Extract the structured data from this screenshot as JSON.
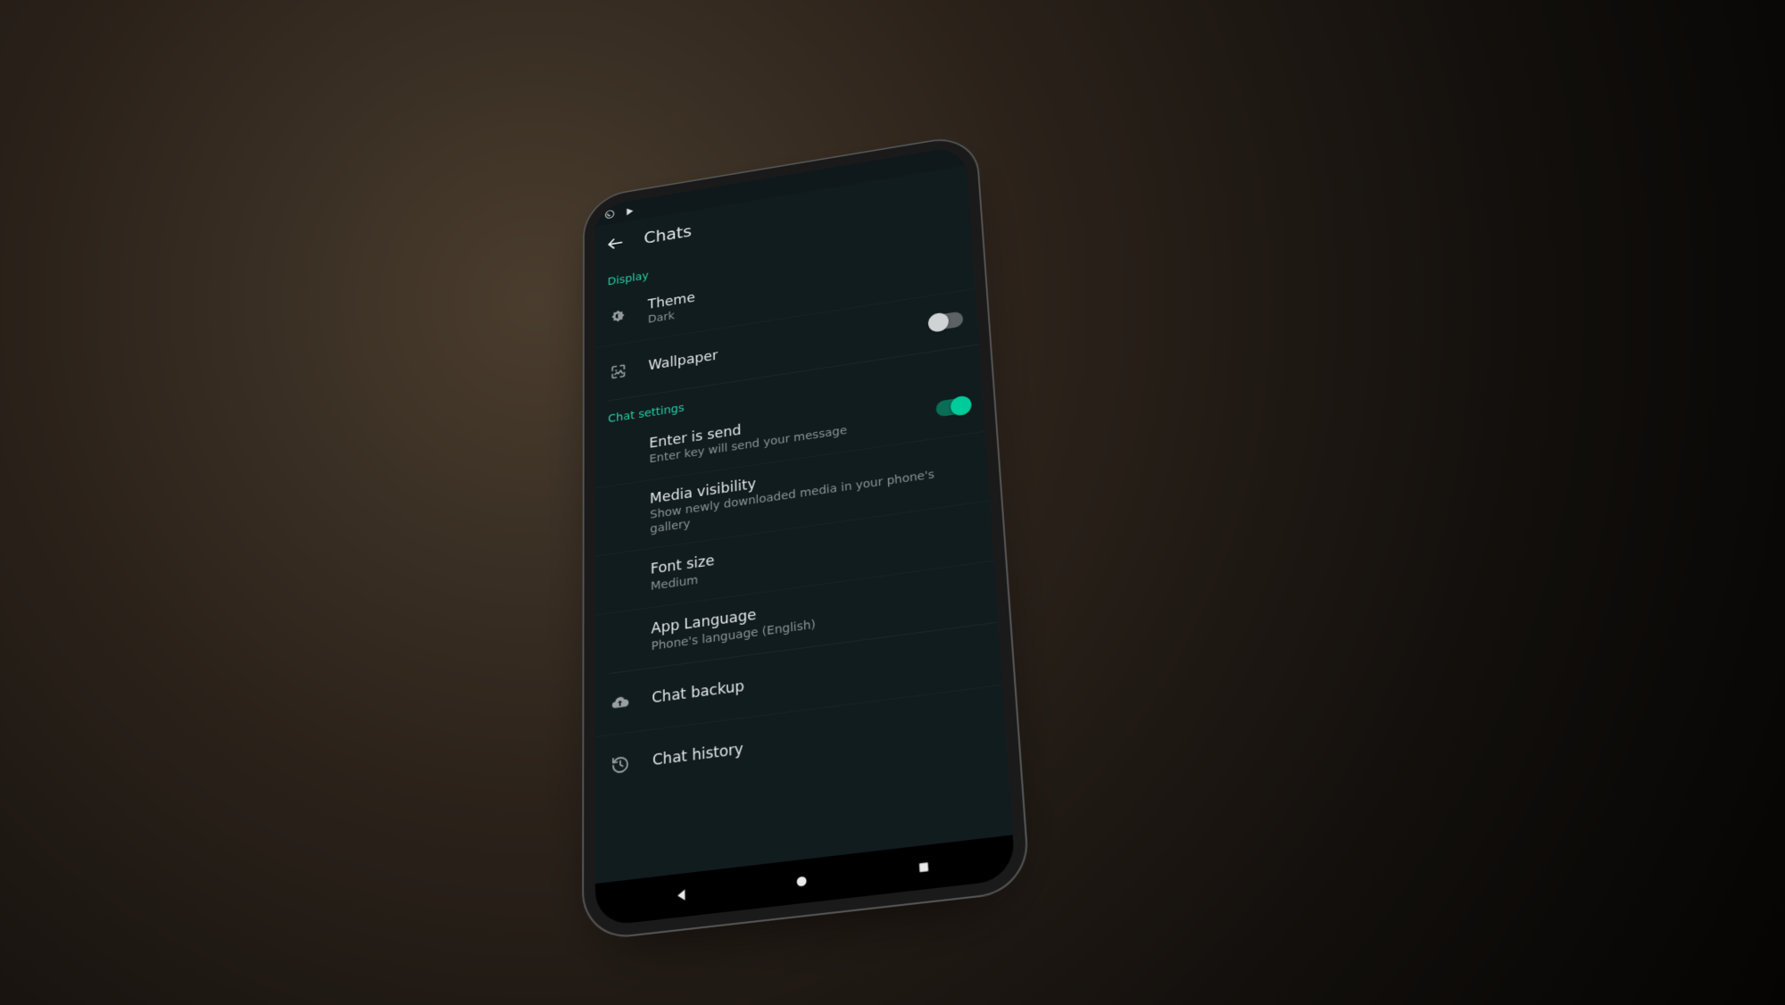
{
  "colors": {
    "accent": "#00cc9b",
    "sectionHeader": "#25d0a6",
    "screenBg": "#111c1e",
    "textPrimary": "#e5e9ea",
    "textSecondary": "#8c9496"
  },
  "appbar": {
    "title": "Chats"
  },
  "sections": [
    {
      "header": "Display",
      "items": [
        {
          "key": "theme",
          "title": "Theme",
          "sub": "Dark"
        },
        {
          "key": "wallpaper",
          "title": "Wallpaper",
          "toggle": false
        }
      ]
    },
    {
      "header": "Chat settings",
      "items": [
        {
          "key": "enterSend",
          "title": "Enter is send",
          "sub": "Enter key will send your message",
          "toggle": true
        },
        {
          "key": "mediaVisibility",
          "title": "Media visibility",
          "sub": "Show newly downloaded media in your phone's gallery"
        },
        {
          "key": "fontSize",
          "title": "Font size",
          "sub": "Medium"
        },
        {
          "key": "appLanguage",
          "title": "App Language",
          "sub": "Phone's language (English)"
        }
      ]
    },
    {
      "header": null,
      "items": [
        {
          "key": "chatBackup",
          "title": "Chat backup"
        },
        {
          "key": "chatHistory",
          "title": "Chat history"
        }
      ]
    }
  ]
}
